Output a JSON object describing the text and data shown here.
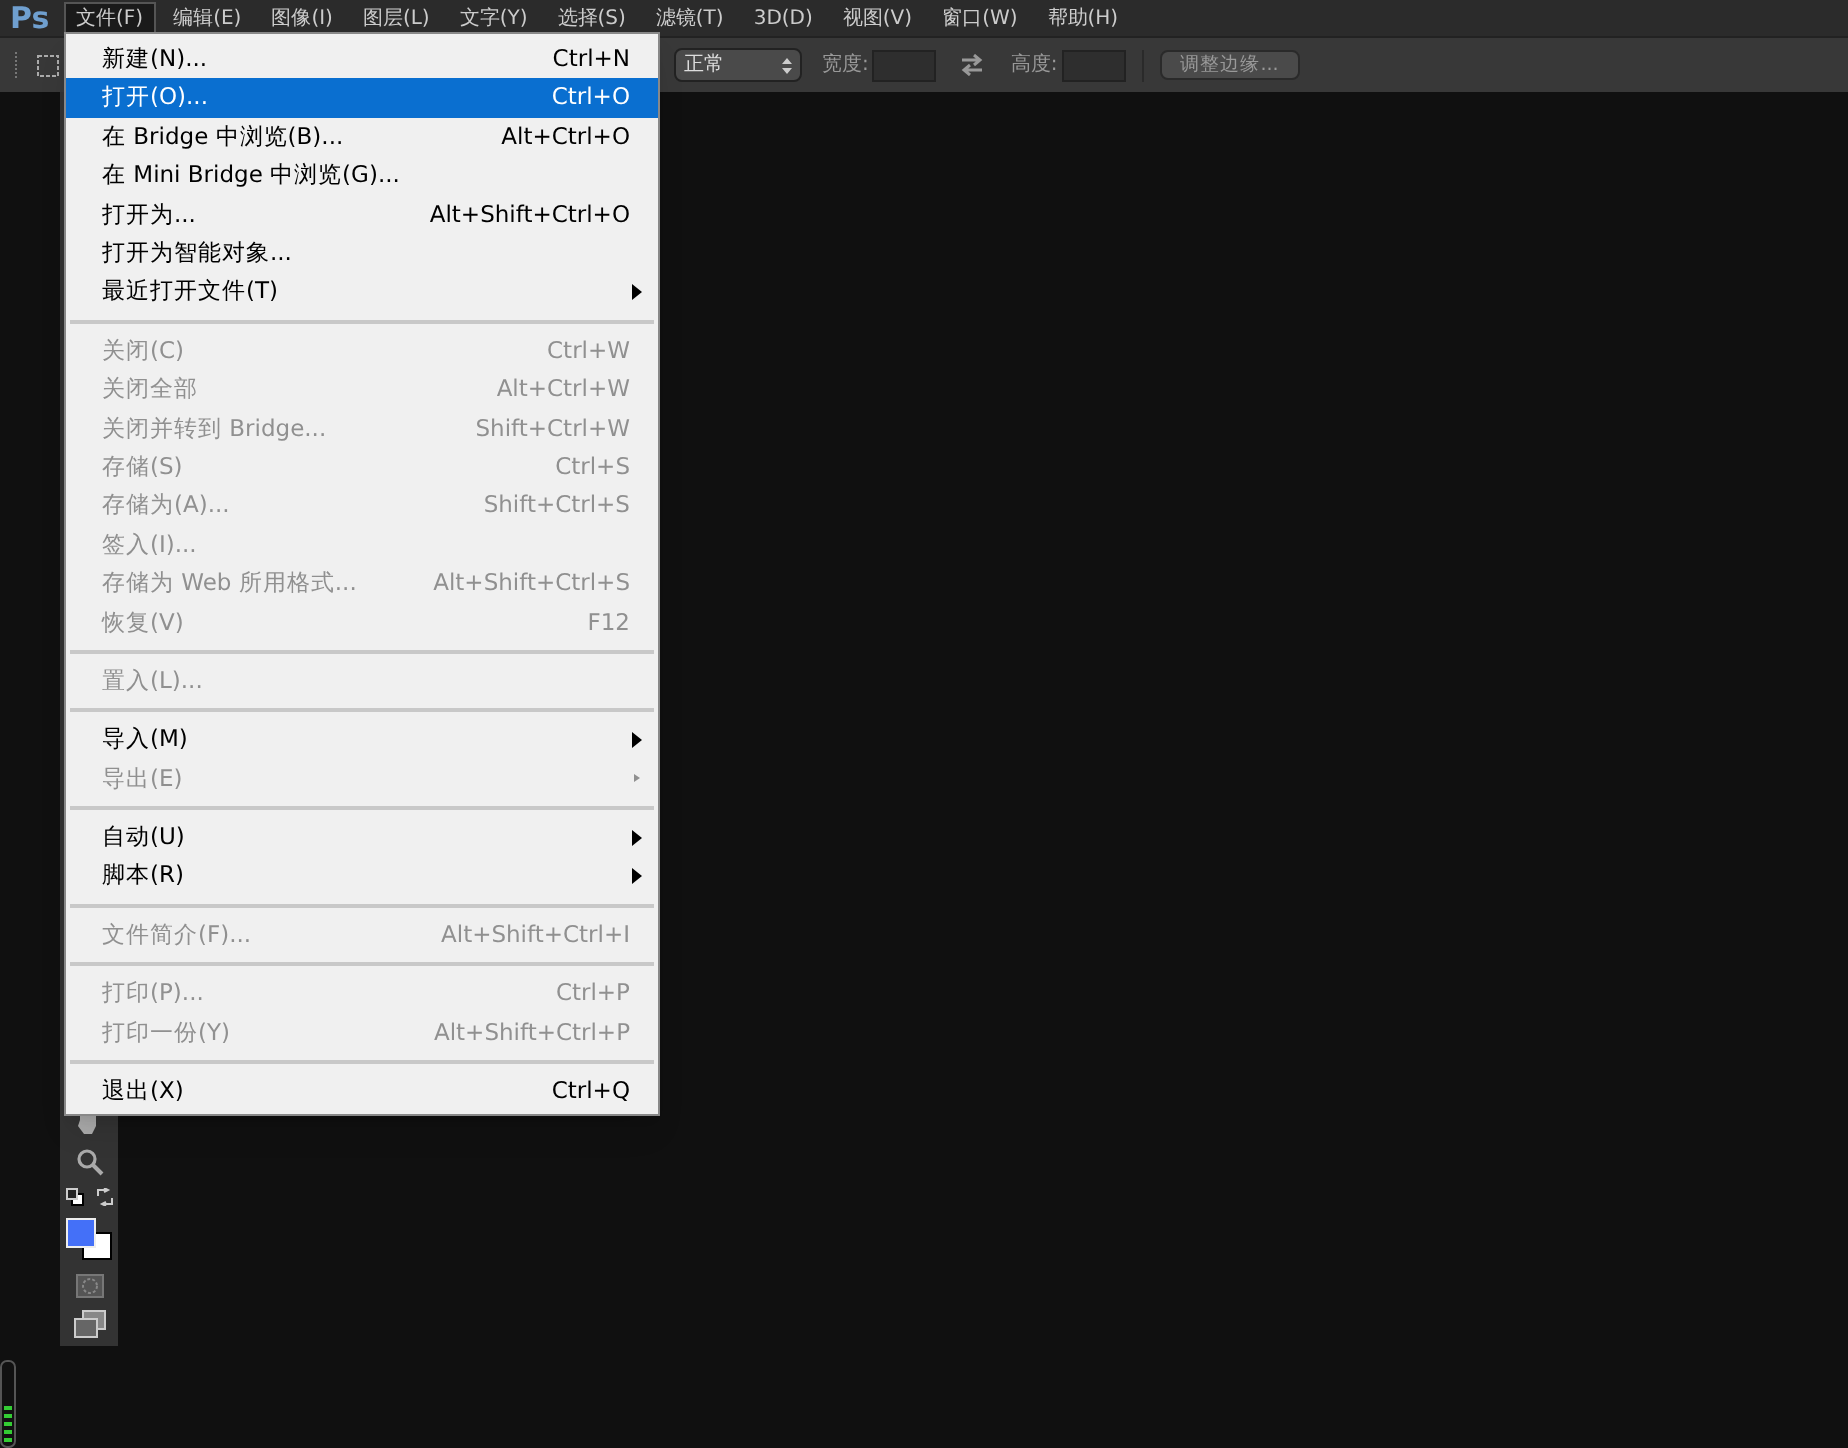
{
  "app_logo": "Ps",
  "menubar": [
    {
      "label": "文件(F)",
      "selected": true
    },
    {
      "label": "编辑(E)",
      "selected": false
    },
    {
      "label": "图像(I)",
      "selected": false
    },
    {
      "label": "图层(L)",
      "selected": false
    },
    {
      "label": "文字(Y)",
      "selected": false
    },
    {
      "label": "选择(S)",
      "selected": false
    },
    {
      "label": "滤镜(T)",
      "selected": false
    },
    {
      "label": "3D(D)",
      "selected": false
    },
    {
      "label": "视图(V)",
      "selected": false
    },
    {
      "label": "窗口(W)",
      "selected": false
    },
    {
      "label": "帮助(H)",
      "selected": false
    }
  ],
  "options_bar": {
    "style_value": "正常",
    "width_label": "宽度:",
    "height_label": "高度:",
    "refine_button": "调整边缘..."
  },
  "file_menu": [
    {
      "kind": "item",
      "label": "新建(N)...",
      "shortcut": "Ctrl+N",
      "disabled": false,
      "selected": false,
      "submenu": false
    },
    {
      "kind": "item",
      "label": "打开(O)...",
      "shortcut": "Ctrl+O",
      "disabled": false,
      "selected": true,
      "submenu": false
    },
    {
      "kind": "item",
      "label": "在 Bridge 中浏览(B)...",
      "shortcut": "Alt+Ctrl+O",
      "disabled": false,
      "selected": false,
      "submenu": false
    },
    {
      "kind": "item",
      "label": "在 Mini Bridge 中浏览(G)...",
      "disabled": false,
      "selected": false,
      "submenu": false
    },
    {
      "kind": "item",
      "label": "打开为...",
      "shortcut": "Alt+Shift+Ctrl+O",
      "disabled": false,
      "selected": false,
      "submenu": false
    },
    {
      "kind": "item",
      "label": "打开为智能对象...",
      "disabled": false,
      "selected": false,
      "submenu": false
    },
    {
      "kind": "item",
      "label": "最近打开文件(T)",
      "disabled": false,
      "selected": false,
      "submenu": true
    },
    {
      "kind": "separator"
    },
    {
      "kind": "item",
      "label": "关闭(C)",
      "shortcut": "Ctrl+W",
      "disabled": true,
      "selected": false,
      "submenu": false
    },
    {
      "kind": "item",
      "label": "关闭全部",
      "shortcut": "Alt+Ctrl+W",
      "disabled": true,
      "selected": false,
      "submenu": false
    },
    {
      "kind": "item",
      "label": "关闭并转到 Bridge...",
      "shortcut": "Shift+Ctrl+W",
      "disabled": true,
      "selected": false,
      "submenu": false
    },
    {
      "kind": "item",
      "label": "存储(S)",
      "shortcut": "Ctrl+S",
      "disabled": true,
      "selected": false,
      "submenu": false
    },
    {
      "kind": "item",
      "label": "存储为(A)...",
      "shortcut": "Shift+Ctrl+S",
      "disabled": true,
      "selected": false,
      "submenu": false
    },
    {
      "kind": "item",
      "label": "签入(I)...",
      "disabled": true,
      "selected": false,
      "submenu": false
    },
    {
      "kind": "item",
      "label": "存储为 Web 所用格式...",
      "shortcut": "Alt+Shift+Ctrl+S",
      "disabled": true,
      "selected": false,
      "submenu": false
    },
    {
      "kind": "item",
      "label": "恢复(V)",
      "shortcut": "F12",
      "disabled": true,
      "selected": false,
      "submenu": false
    },
    {
      "kind": "separator"
    },
    {
      "kind": "item",
      "label": "置入(L)...",
      "disabled": true,
      "selected": false,
      "submenu": false
    },
    {
      "kind": "separator"
    },
    {
      "kind": "item",
      "label": "导入(M)",
      "disabled": false,
      "selected": false,
      "submenu": true
    },
    {
      "kind": "item",
      "label": "导出(E)",
      "disabled": true,
      "selected": false,
      "submenu": true
    },
    {
      "kind": "separator"
    },
    {
      "kind": "item",
      "label": "自动(U)",
      "disabled": false,
      "selected": false,
      "submenu": true
    },
    {
      "kind": "item",
      "label": "脚本(R)",
      "disabled": false,
      "selected": false,
      "submenu": true
    },
    {
      "kind": "separator"
    },
    {
      "kind": "item",
      "label": "文件简介(F)...",
      "shortcut": "Alt+Shift+Ctrl+I",
      "disabled": true,
      "selected": false,
      "submenu": false
    },
    {
      "kind": "separator"
    },
    {
      "kind": "item",
      "label": "打印(P)...",
      "shortcut": "Ctrl+P",
      "disabled": true,
      "selected": false,
      "submenu": false
    },
    {
      "kind": "item",
      "label": "打印一份(Y)",
      "shortcut": "Alt+Shift+Ctrl+P",
      "disabled": true,
      "selected": false,
      "submenu": false
    },
    {
      "kind": "separator"
    },
    {
      "kind": "item",
      "label": "退出(X)",
      "shortcut": "Ctrl+Q",
      "disabled": false,
      "selected": false,
      "submenu": false
    }
  ]
}
